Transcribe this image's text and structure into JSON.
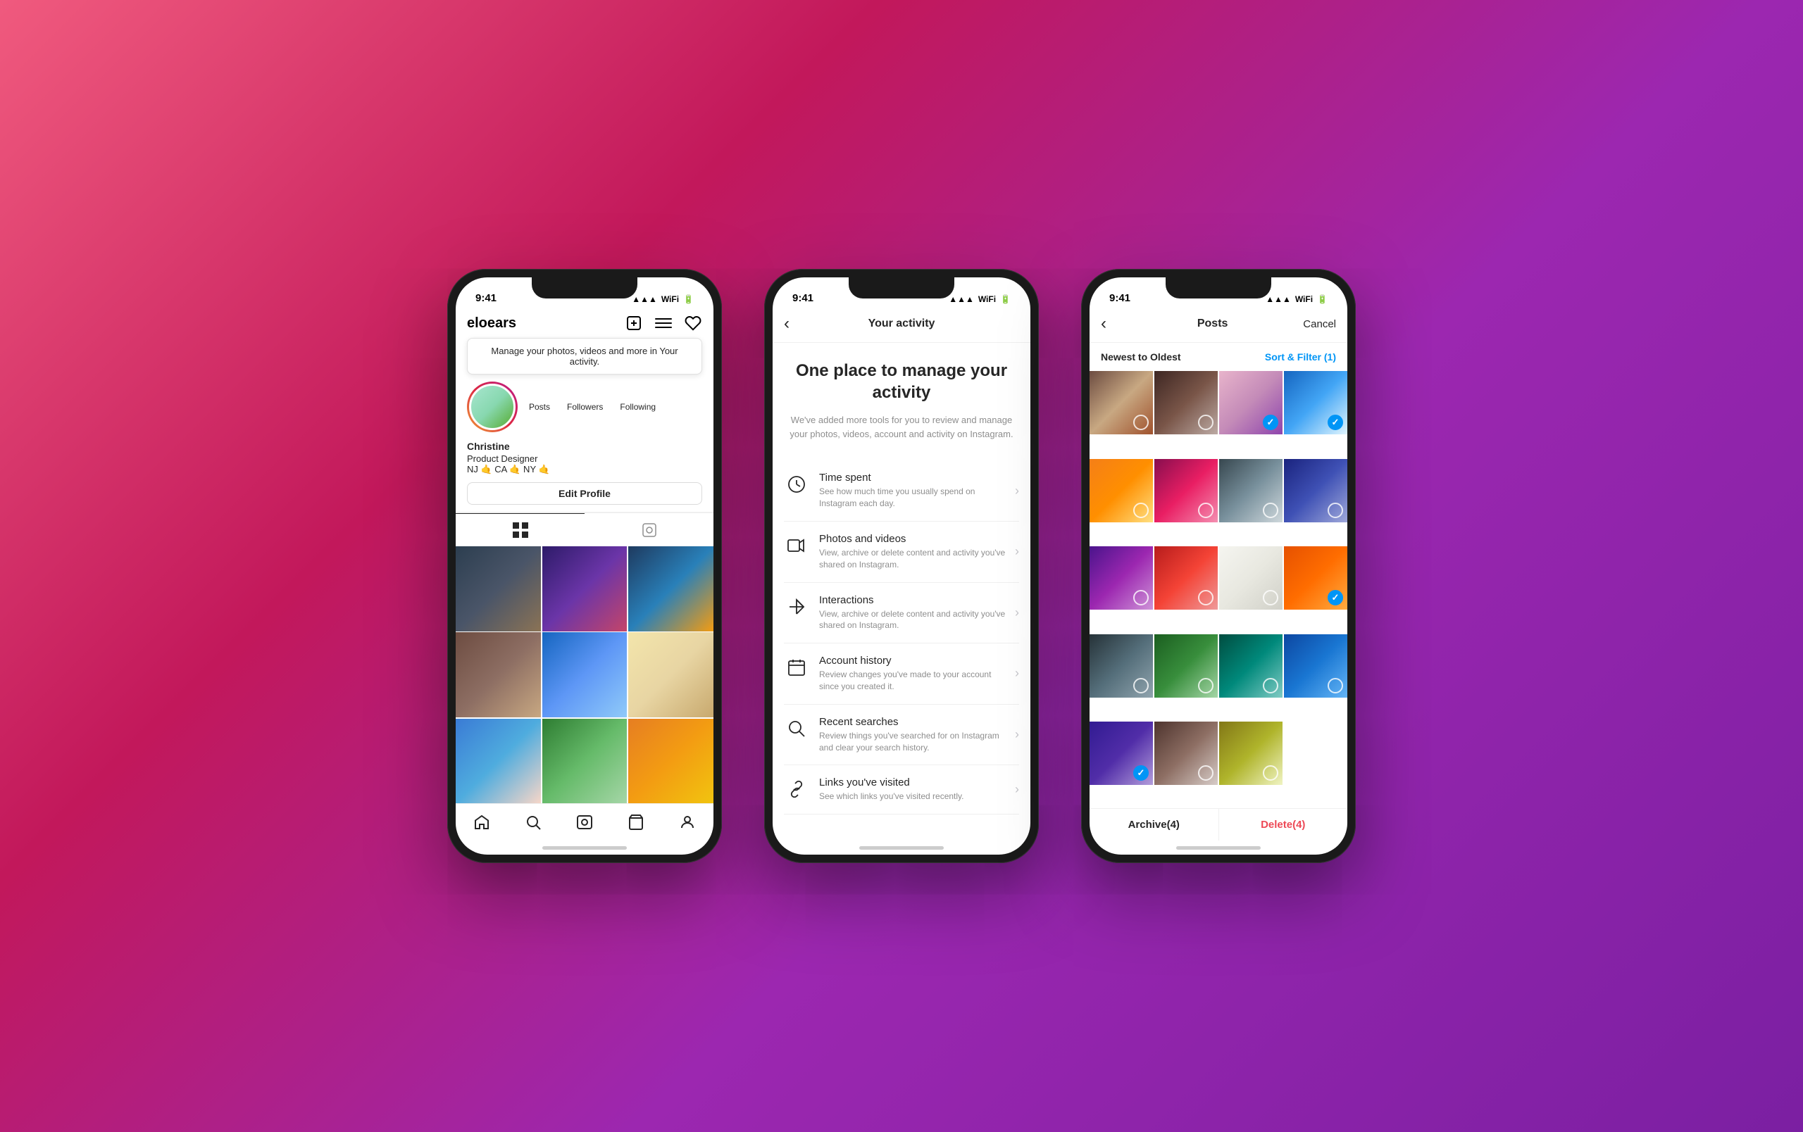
{
  "background": {
    "gradient": "135deg, #f05a7e 0%, #c2185b 30%, #9c27b0 60%, #7b1fa2 100%"
  },
  "phone1": {
    "status_time": "9:41",
    "username": "eloears",
    "tooltip": "Manage your photos, videos and more in Your activity.",
    "stats": [
      {
        "num": "",
        "label": "Posts"
      },
      {
        "num": "",
        "label": "Followers"
      },
      {
        "num": "",
        "label": "Following"
      }
    ],
    "name": "Christine",
    "bio1": "Product Designer",
    "bio2": "NJ 🤙 CA 🤙 NY 🤙",
    "edit_profile_label": "Edit Profile",
    "grid_tab_active": "grid",
    "nav": [
      "home",
      "search",
      "reels",
      "shop",
      "profile"
    ]
  },
  "phone2": {
    "status_time": "9:41",
    "header_title": "Your activity",
    "hero_title": "One place to manage your activity",
    "hero_desc": "We've added more tools for you to review and manage your photos, videos, account and activity on Instagram.",
    "items": [
      {
        "icon": "clock",
        "title": "Time spent",
        "desc": "See how much time you usually spend on Instagram each day."
      },
      {
        "icon": "photos",
        "title": "Photos and videos",
        "desc": "View, archive or delete content and activity you've shared on Instagram."
      },
      {
        "icon": "interactions",
        "title": "Interactions",
        "desc": "View, archive or delete content and activity you've shared on Instagram."
      },
      {
        "icon": "calendar",
        "title": "Account history",
        "desc": "Review changes you've made to your account since you created it."
      },
      {
        "icon": "search",
        "title": "Recent searches",
        "desc": "Review things you've searched for on Instagram and clear your search history."
      },
      {
        "icon": "link",
        "title": "Links you've visited",
        "desc": "See which links you've visited recently."
      }
    ]
  },
  "phone3": {
    "status_time": "9:41",
    "header_title": "Posts",
    "cancel_label": "Cancel",
    "sort_label": "Newest to Oldest",
    "sort_filter_label": "Sort & Filter (1)",
    "selected_count": 4,
    "archive_label": "Archive(4)",
    "delete_label": "Delete(4)",
    "cells": [
      {
        "color": "lin1",
        "checked": false
      },
      {
        "color": "lin2",
        "checked": false
      },
      {
        "color": "lin3",
        "checked": true
      },
      {
        "color": "lin4",
        "checked": true
      },
      {
        "color": "lin5",
        "checked": false
      },
      {
        "color": "lin6",
        "checked": false
      },
      {
        "color": "lin7",
        "checked": false
      },
      {
        "color": "lin8",
        "checked": false
      },
      {
        "color": "lin9",
        "checked": false
      },
      {
        "color": "lin10",
        "checked": false
      },
      {
        "color": "lin11",
        "checked": false
      },
      {
        "color": "lin12",
        "checked": true
      },
      {
        "color": "lin13",
        "checked": false
      },
      {
        "color": "lin14",
        "checked": false
      },
      {
        "color": "lin15",
        "checked": false
      },
      {
        "color": "lin16",
        "checked": false
      },
      {
        "color": "lin17",
        "checked": true
      },
      {
        "color": "lin18",
        "checked": false
      },
      {
        "color": "lin19",
        "checked": false
      },
      {
        "color": "lin20",
        "checked": false
      }
    ]
  }
}
